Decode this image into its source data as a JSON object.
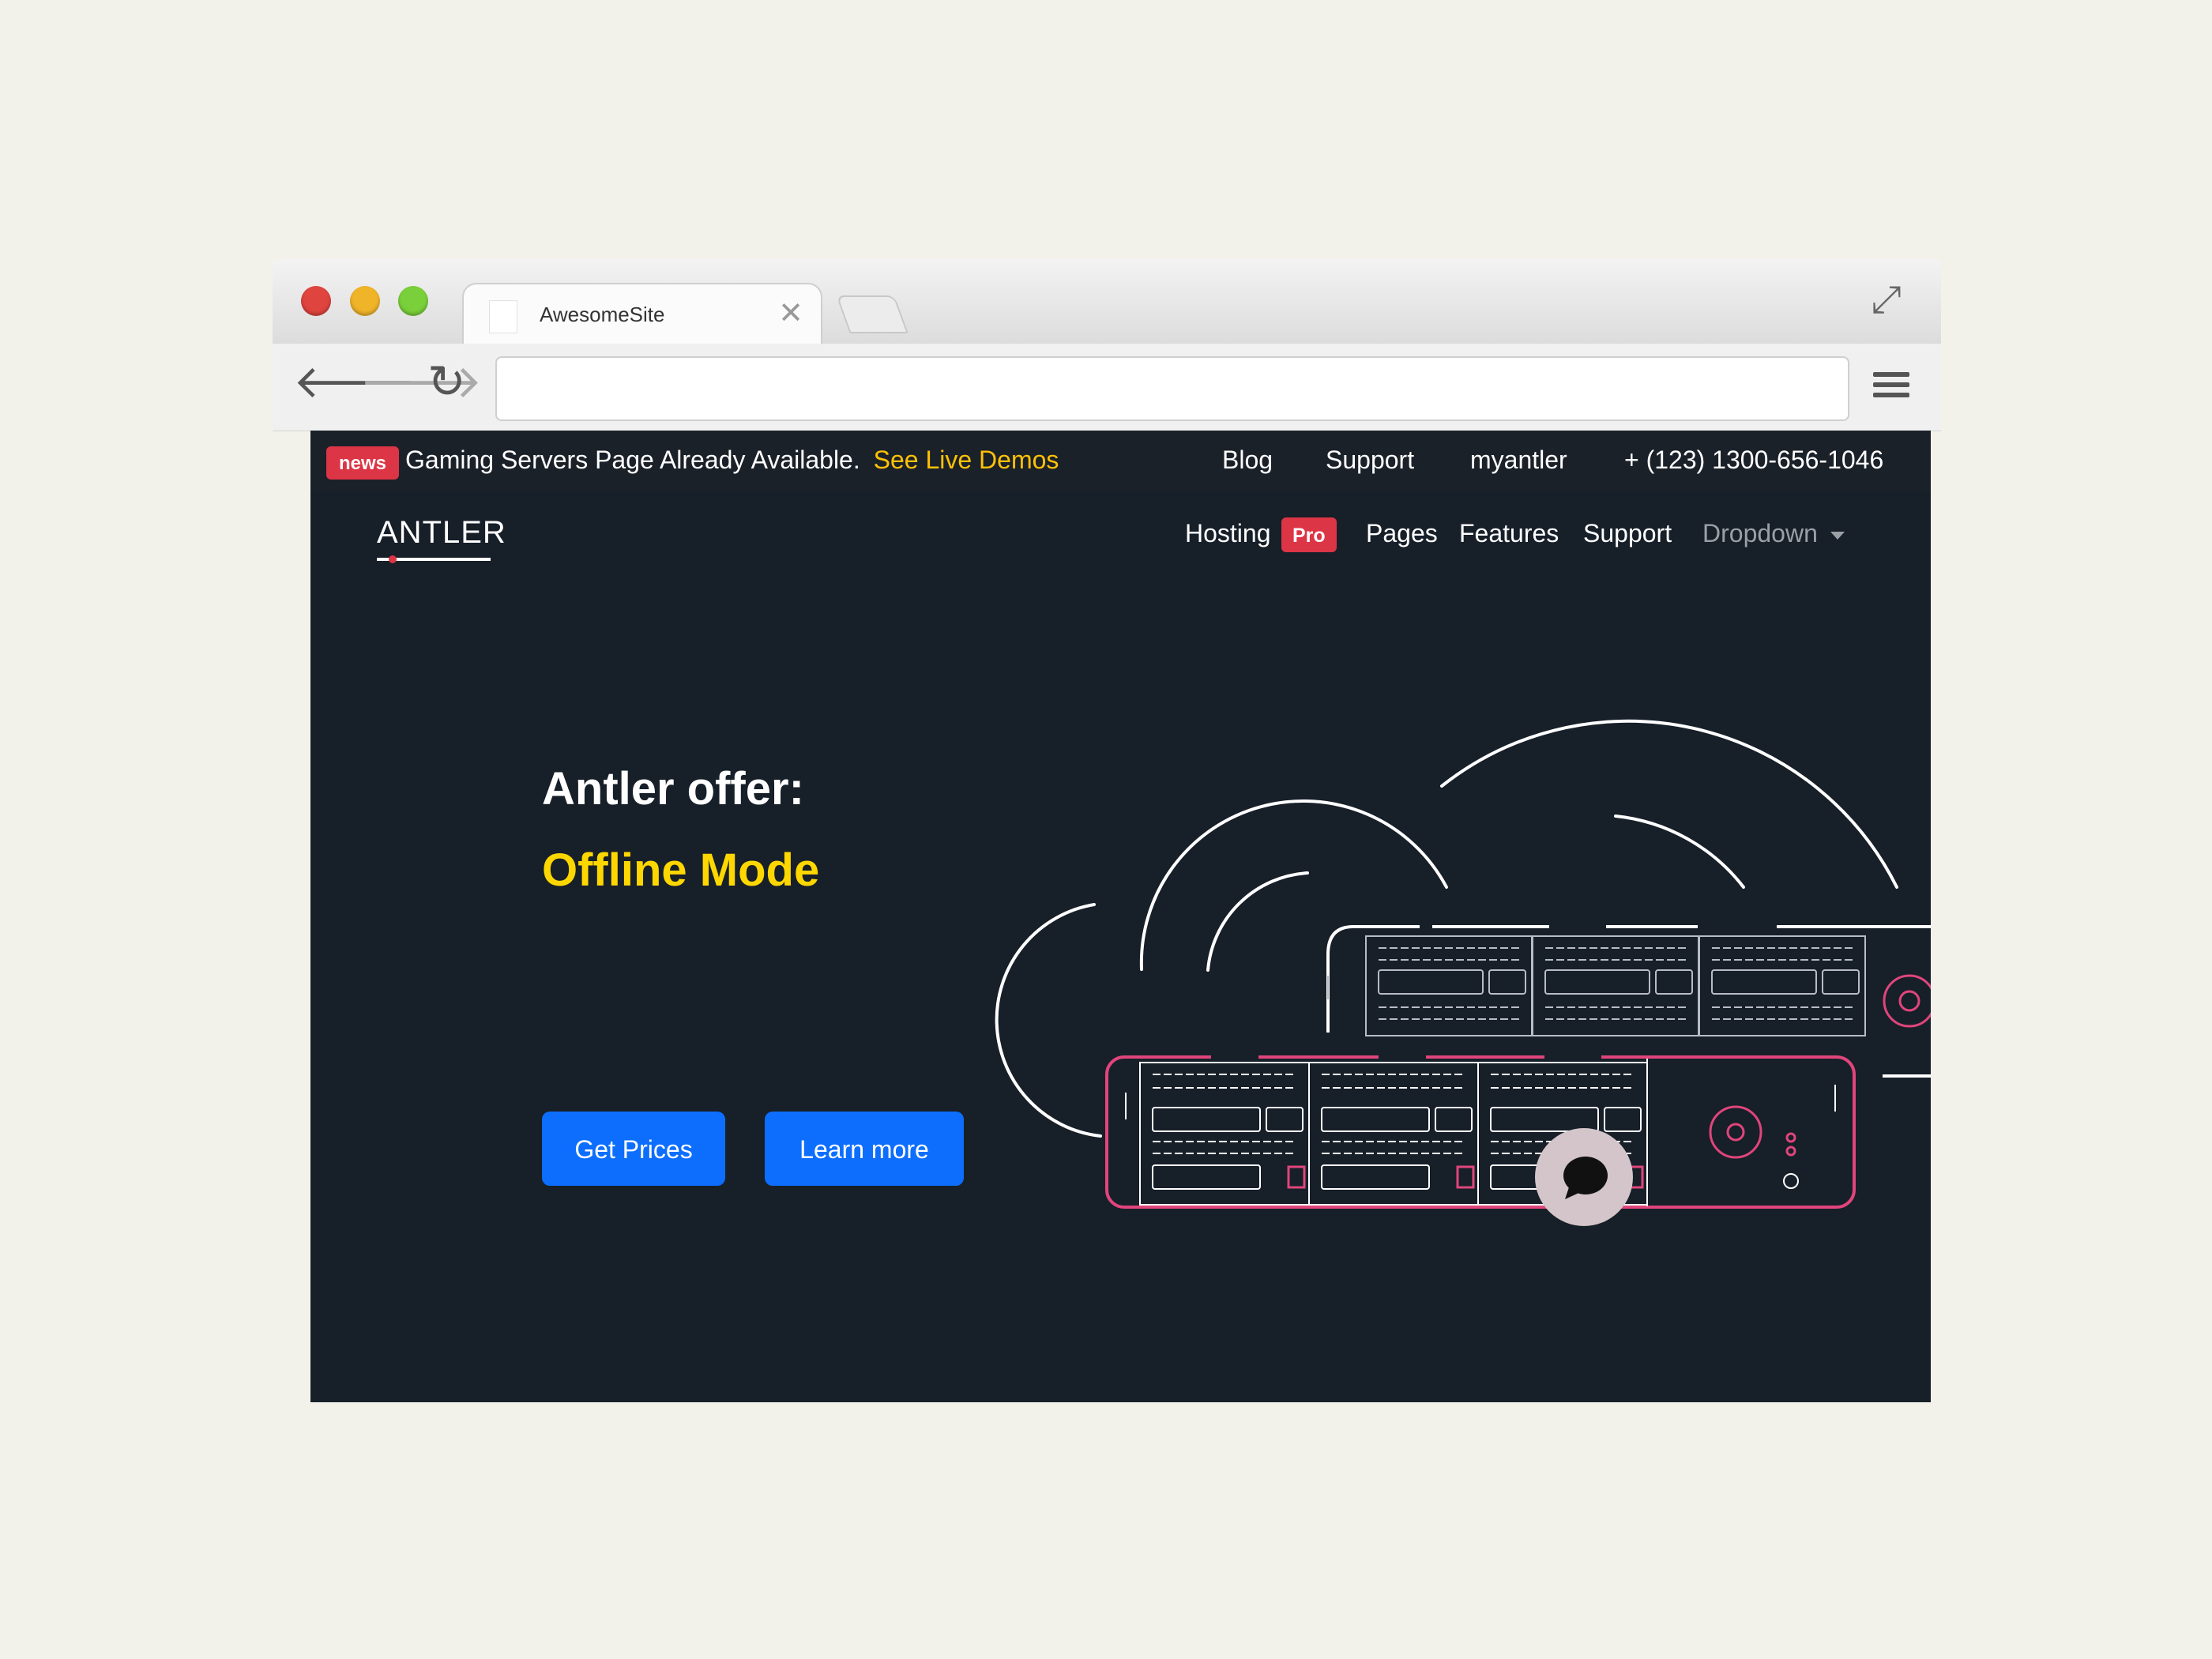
{
  "browser": {
    "tab_title": "AwesomeSite",
    "tab_close": "✕",
    "address_value": "",
    "back_icon": "arrow-left-icon",
    "forward_icon": "arrow-right-icon",
    "reload_icon": "reload-icon",
    "menu_icon": "hamburger-menu-icon",
    "expand_icon": "expand-icon"
  },
  "topbar": {
    "badge": "news",
    "message": "Gaming Servers Page Already Available.",
    "link": "See Live Demos",
    "links": [
      "Blog",
      "Support",
      "myantler"
    ],
    "phone": "+ (123) 1300-656-1046"
  },
  "nav": {
    "logo": "ANTLER",
    "items": [
      "Hosting",
      "Pages",
      "Features",
      "Support"
    ],
    "pro_badge": "Pro",
    "dropdown": "Dropdown"
  },
  "hero": {
    "title": "Antler offer:",
    "subtitle": "Offline Mode",
    "primary_button": "Get Prices",
    "secondary_button": "Learn more"
  },
  "colors": {
    "page_bg": "#171f29",
    "accent_red": "#dc3545",
    "accent_yellow": "#ffd700",
    "link_yellow": "#ffc107",
    "button_blue": "#0d6efd",
    "illustration_pink": "#e0457b"
  }
}
